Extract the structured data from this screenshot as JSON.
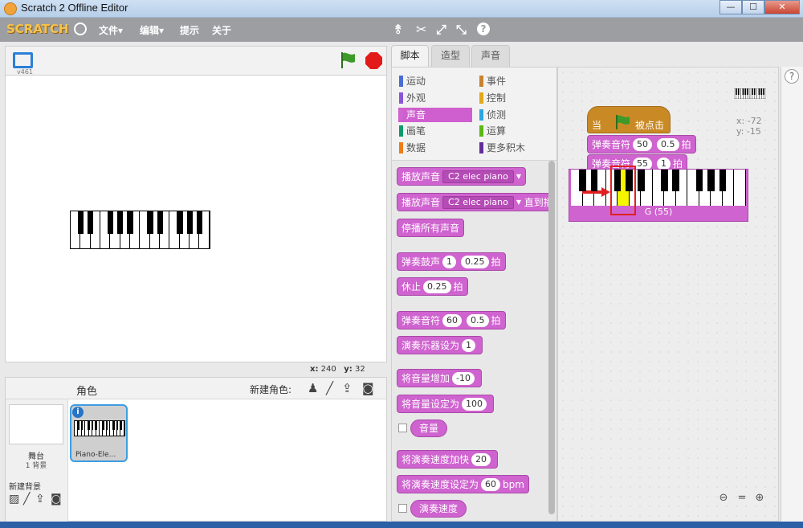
{
  "window": {
    "title": "Scratch 2 Offline Editor",
    "min": "—",
    "max": "☐",
    "close": "✕"
  },
  "menu": {
    "logo": "SCRATCH",
    "file": "文件▾",
    "edit": "编辑▾",
    "tips": "提示",
    "about": "关于"
  },
  "stage": {
    "version": "v461",
    "coord_x_label": "x:",
    "coord_x": "240",
    "coord_y_label": "y:",
    "coord_y": "32"
  },
  "sprites": {
    "label": "角色",
    "new_sprite": "新建角色:",
    "stage_label": "舞台",
    "backdrop_count": "1 背景",
    "new_backdrop": "新建背景",
    "sprite_name": "Piano-Ele..."
  },
  "tabs": [
    "脚本",
    "造型",
    "声音"
  ],
  "categories": {
    "left": [
      "运动",
      "外观",
      "声音",
      "画笔",
      "数据"
    ],
    "right": [
      "事件",
      "控制",
      "侦测",
      "运算",
      "更多积木"
    ],
    "selected": "声音"
  },
  "blocks": {
    "play_sound": "播放声音",
    "sound_name": "C2 elec piano",
    "play_sound_until": "播放声音",
    "until_done": "直到播",
    "stop_all": "停播所有声音",
    "play_drum": "弹奏鼓声",
    "drum_val": "1",
    "drum_beats": "0.25",
    "beat": "拍",
    "rest": "休止",
    "rest_val": "0.25",
    "play_note": "弹奏音符",
    "note_val": "60",
    "note_beats": "0.5",
    "set_instrument": "演奏乐器设为",
    "instrument_val": "1",
    "change_volume": "将音量增加",
    "volume_delta": "-10",
    "set_volume": "将音量设定为",
    "volume_val": "100",
    "volume": "音量",
    "change_tempo": "将演奏速度加快",
    "tempo_delta": "20",
    "set_tempo": "将演奏速度设定为",
    "tempo_val": "60",
    "bpm": "bpm",
    "tempo": "演奏速度"
  },
  "script": {
    "hat_when": "当",
    "hat_clicked": "被点击",
    "note1": "弹奏音符",
    "note1_val": "50",
    "note1_beats": "0.5",
    "note1_beat": "拍",
    "note2": "弹奏音符",
    "note2_val": "55",
    "note2_beats": "1",
    "note2_beat": "拍",
    "keyboard_label": "G (55)",
    "sprite_x": "x: -72",
    "sprite_y": "y: -15"
  },
  "colors": {
    "sound": "#cf63cf",
    "events": "#c98a26",
    "highlight": "#f5f500",
    "annotation": "#e02020"
  }
}
